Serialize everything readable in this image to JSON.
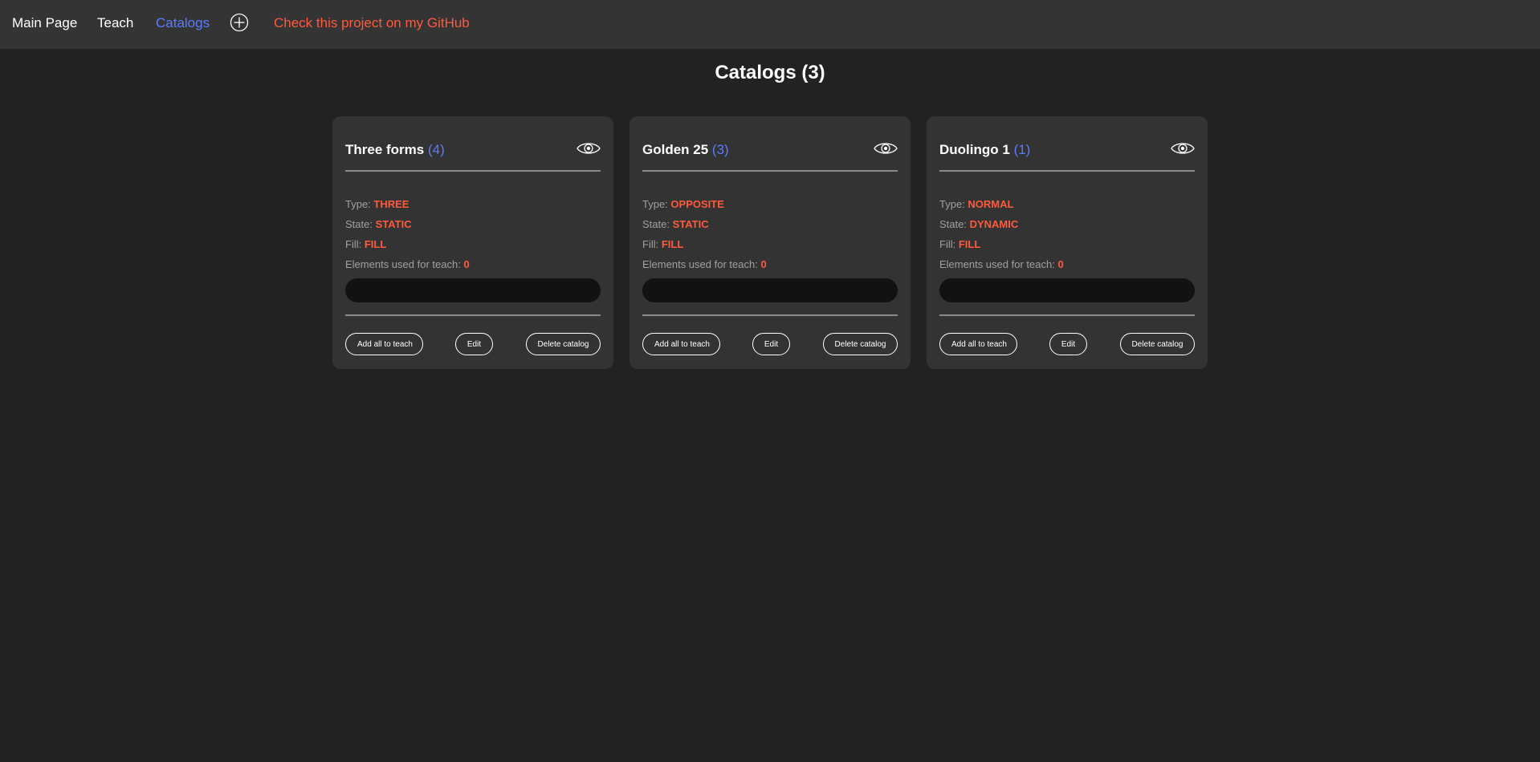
{
  "nav": {
    "main_page": "Main Page",
    "teach": "Teach",
    "catalogs": "Catalogs",
    "add_icon": "plus-circle-icon",
    "github": "Check this project on my GitHub"
  },
  "page": {
    "title": "Catalogs (3)"
  },
  "labels": {
    "type": "Type:",
    "state": "State:",
    "fill": "Fill:",
    "elements": "Elements used for teach:",
    "add_all": "Add all to teach",
    "edit": "Edit",
    "delete": "Delete catalog"
  },
  "colors": {
    "accent_blue": "#5b7cff",
    "accent_red": "#ff5a3c",
    "background": "#222222",
    "card": "#333333",
    "navbar": "#343434"
  },
  "catalogs": [
    {
      "name": "Three forms",
      "count": "(4)",
      "type": "THREE",
      "state": "STATIC",
      "fill": "FILL",
      "elements": "0",
      "progress_percent": 0
    },
    {
      "name": "Golden 25",
      "count": "(3)",
      "type": "OPPOSITE",
      "state": "STATIC",
      "fill": "FILL",
      "elements": "0",
      "progress_percent": 0
    },
    {
      "name": "Duolingo 1",
      "count": "(1)",
      "type": "NORMAL",
      "state": "DYNAMIC",
      "fill": "FILL",
      "elements": "0",
      "progress_percent": 0
    }
  ]
}
